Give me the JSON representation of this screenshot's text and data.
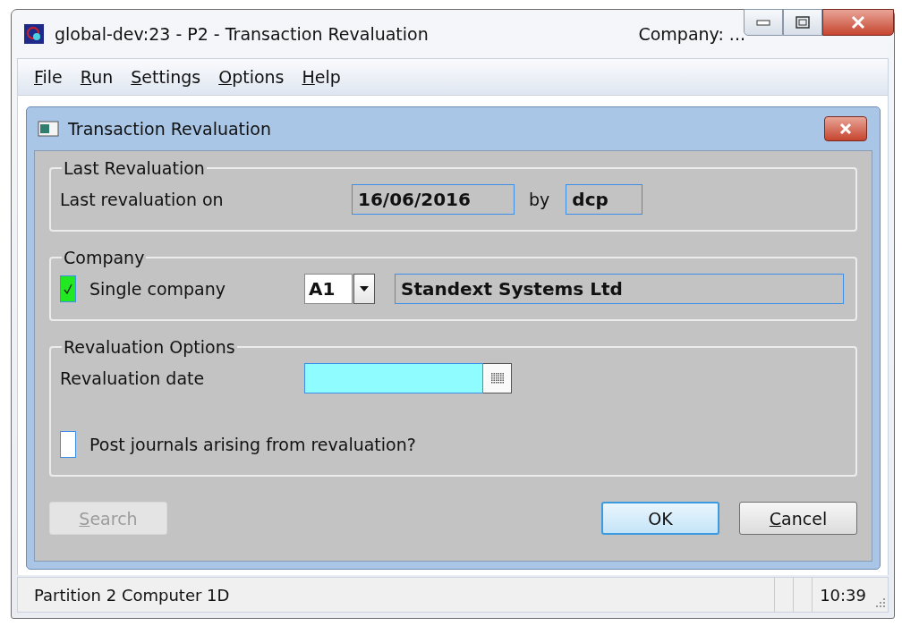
{
  "window": {
    "title": "global-dev:23 - P2 - Transaction Revaluation",
    "company": "Company: ..."
  },
  "menu": [
    {
      "label": "File",
      "mnemonic": true
    },
    {
      "label": "Run",
      "mnemonic": true
    },
    {
      "label": "Settings",
      "mnemonic": true
    },
    {
      "label": "Options",
      "mnemonic": true
    },
    {
      "label": "Help",
      "mnemonic": true
    }
  ],
  "dialog": {
    "title": "Transaction Revaluation",
    "last_revaluation": {
      "title": "Last Revaluation",
      "label": "Last revaluation on",
      "date": "16/06/2016",
      "by_label": "by",
      "user": "dcp"
    },
    "company": {
      "title": "Company",
      "checkbox": {
        "label": "Single company",
        "checked": true
      },
      "code": "A1",
      "name": "Standext Systems Ltd"
    },
    "options": {
      "title": "Revaluation Options",
      "date_label": "Revaluation date",
      "post_journals": {
        "label": "Post journals arising from revaluation?",
        "checked": false
      }
    },
    "buttons": [
      {
        "label": "Search",
        "mnemonic": true,
        "disabled": true,
        "default": false
      },
      {
        "label": "OK",
        "mnemonic": false,
        "disabled": false,
        "default": true
      },
      {
        "label": "Cancel",
        "mnemonic": true,
        "disabled": false,
        "default": false
      }
    ]
  },
  "status_bar": {
    "text": "Partition 2 Computer 1D",
    "time": "10:39"
  }
}
